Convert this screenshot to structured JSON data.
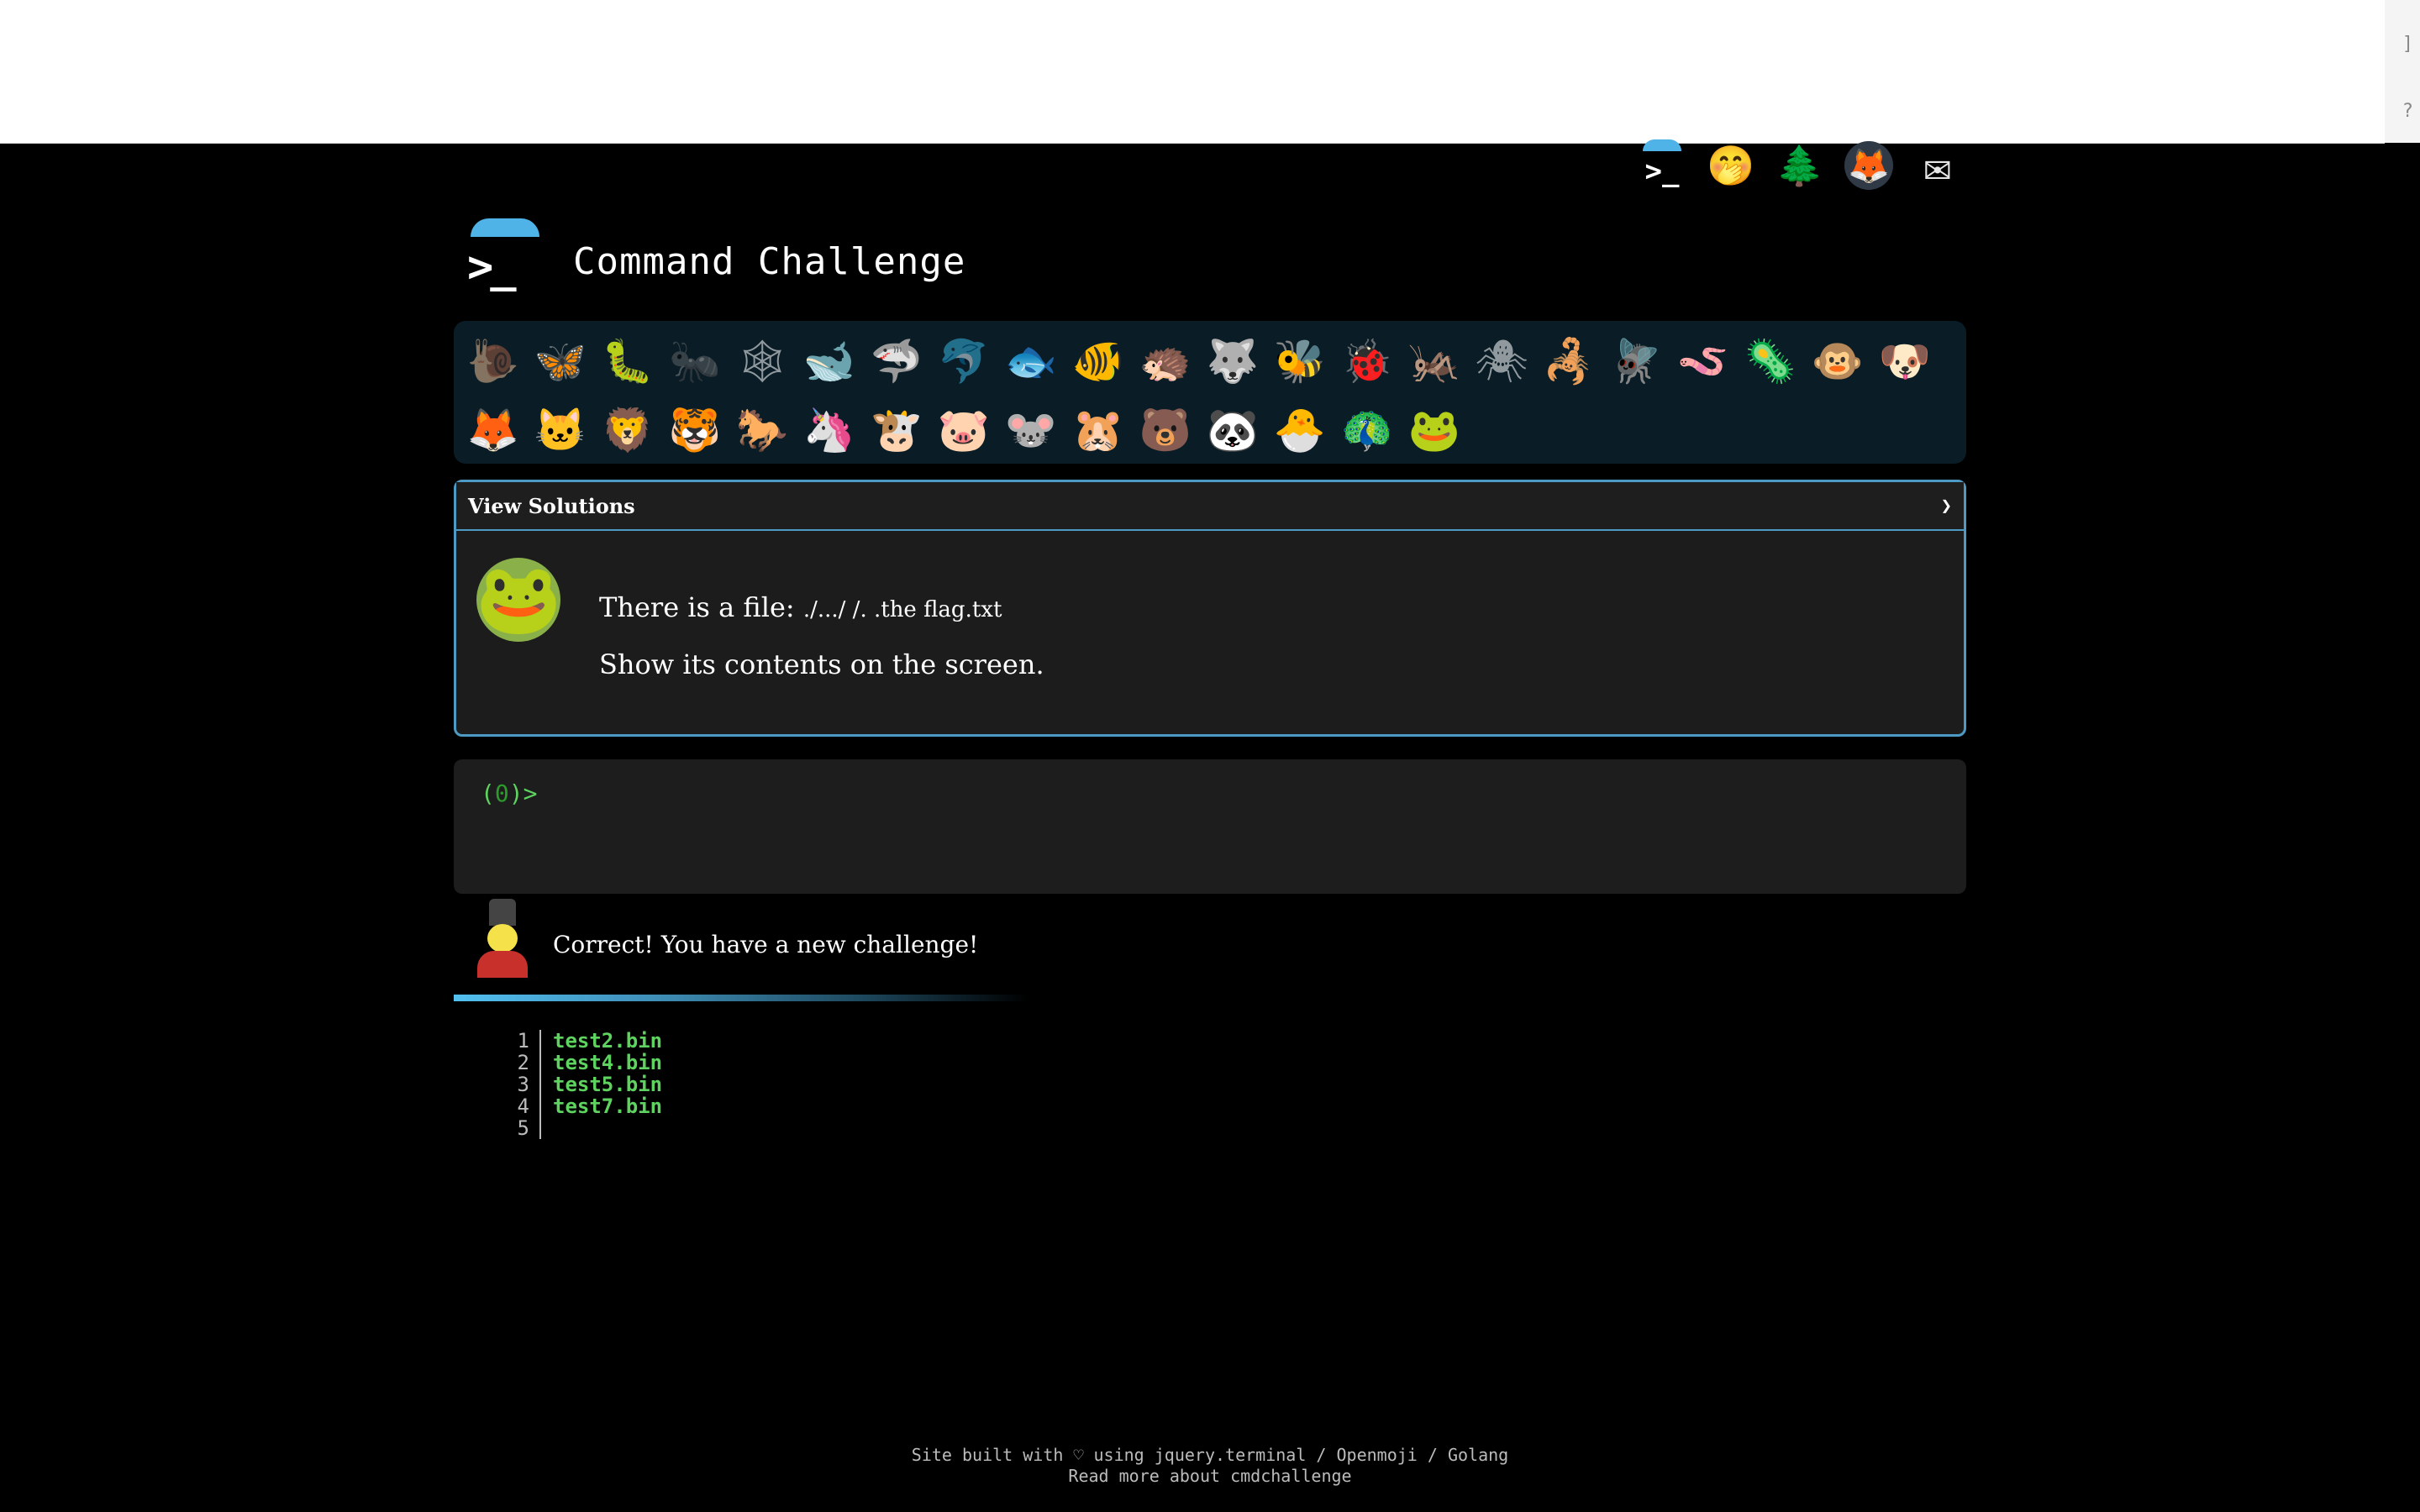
{
  "header": {
    "icons": [
      {
        "name": "terminal-icon",
        "glyph": ">_"
      },
      {
        "name": "shushing-face-icon",
        "glyph": "🤭"
      },
      {
        "name": "tree-icon",
        "glyph": "🌲"
      },
      {
        "name": "gitlab-icon",
        "glyph": "🦊"
      },
      {
        "name": "mail-icon",
        "glyph": "✉"
      }
    ]
  },
  "brand": {
    "logo_glyph": ">_",
    "title": "Command Challenge"
  },
  "animals": [
    {
      "name": "snail",
      "glyph": "🐌",
      "done": false
    },
    {
      "name": "butterfly",
      "glyph": "🦋",
      "done": true
    },
    {
      "name": "caterpillar",
      "glyph": "🐛",
      "done": true
    },
    {
      "name": "ant",
      "glyph": "🐜",
      "done": false
    },
    {
      "name": "spider-web",
      "glyph": "🕸",
      "done": false
    },
    {
      "name": "whale",
      "glyph": "🐋",
      "done": true
    },
    {
      "name": "shark",
      "glyph": "🦈",
      "done": true
    },
    {
      "name": "dolphin",
      "glyph": "🐬",
      "done": false
    },
    {
      "name": "fish",
      "glyph": "🐟",
      "done": true
    },
    {
      "name": "tropical-fish",
      "glyph": "🐠",
      "done": true
    },
    {
      "name": "hedgehog",
      "glyph": "🦔",
      "done": true
    },
    {
      "name": "wolf",
      "glyph": "🐺",
      "done": true
    },
    {
      "name": "bee",
      "glyph": "🐝",
      "done": true
    },
    {
      "name": "ladybug",
      "glyph": "🐞",
      "done": true
    },
    {
      "name": "cricket",
      "glyph": "🦗",
      "done": true
    },
    {
      "name": "spider",
      "glyph": "🕷",
      "done": false
    },
    {
      "name": "scorpion",
      "glyph": "🦂",
      "done": true
    },
    {
      "name": "fly",
      "glyph": "🪰",
      "done": true
    },
    {
      "name": "worm",
      "glyph": "🪱",
      "done": true
    },
    {
      "name": "microbe",
      "glyph": "🦠",
      "done": true
    },
    {
      "name": "monkey",
      "glyph": "🐵",
      "done": true
    },
    {
      "name": "dog",
      "glyph": "🐶",
      "done": true
    },
    {
      "name": "fox",
      "glyph": "🦊",
      "done": true
    },
    {
      "name": "cat",
      "glyph": "🐱",
      "done": true
    },
    {
      "name": "lion",
      "glyph": "🦁",
      "done": true
    },
    {
      "name": "tiger",
      "glyph": "🐯",
      "done": true
    },
    {
      "name": "horse",
      "glyph": "🐎",
      "done": true
    },
    {
      "name": "unicorn",
      "glyph": "🦄",
      "done": true
    },
    {
      "name": "cow",
      "glyph": "🐮",
      "done": true
    },
    {
      "name": "pig",
      "glyph": "🐷",
      "done": true
    },
    {
      "name": "mouse",
      "glyph": "🐭",
      "done": true
    },
    {
      "name": "hamster",
      "glyph": "🐹",
      "done": true
    },
    {
      "name": "bear",
      "glyph": "🐻",
      "done": true
    },
    {
      "name": "panda",
      "glyph": "🐼",
      "done": true
    },
    {
      "name": "hatching-chick",
      "glyph": "🐣",
      "done": true
    },
    {
      "name": "peacock",
      "glyph": "🦚",
      "done": true
    },
    {
      "name": "frog",
      "glyph": "🐸",
      "done": true
    }
  ],
  "solutions": {
    "header": "View Solutions",
    "chevron": "❯",
    "avatar_glyph": "🐸",
    "line1_prefix": "There is a file:",
    "line1_path": "./.../ /. .the flag.txt",
    "line2": "Show its contents on the screen."
  },
  "terminal": {
    "prompt_open": "(",
    "prompt_count": "0",
    "prompt_close": ")>"
  },
  "message": {
    "text": "Correct! You have a new challenge!"
  },
  "progress": 0.38,
  "output": {
    "rows": [
      {
        "ln": "1",
        "text": "test2.bin"
      },
      {
        "ln": "2",
        "text": "test4.bin"
      },
      {
        "ln": "3",
        "text": "test5.bin"
      },
      {
        "ln": "4",
        "text": "test7.bin"
      },
      {
        "ln": "5",
        "text": ""
      }
    ]
  },
  "footer": {
    "line1": "Site built with ♡ using jquery.terminal / Openmoji / Golang",
    "line2": "Read more about cmdchallenge"
  }
}
